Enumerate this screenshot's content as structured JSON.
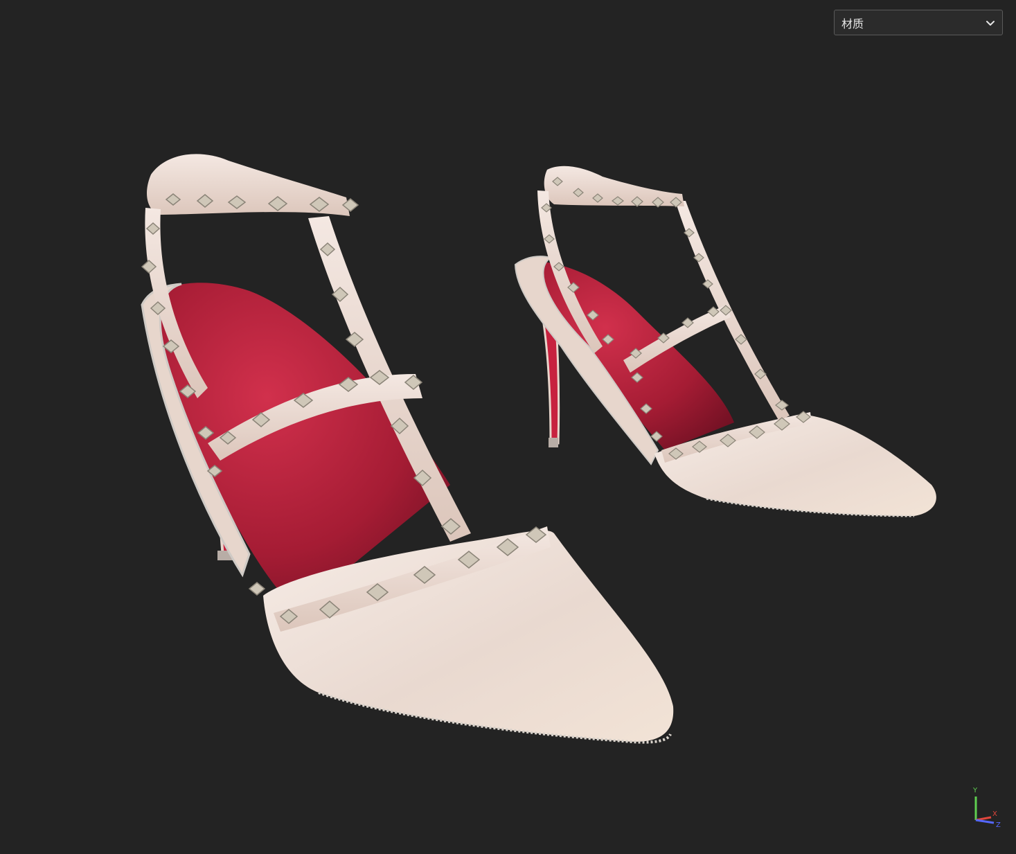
{
  "viewer": {
    "background_color": "#232323"
  },
  "material_select": {
    "selected": "材质",
    "icon": "chevron-down-icon"
  },
  "axis_gizmo": {
    "y_label": "Y",
    "x_label": "X",
    "z_label": "Z",
    "colors": {
      "x": "#e0463c",
      "y": "#5fcf50",
      "z": "#5567ff"
    }
  },
  "model": {
    "upper_color": "#efe0d8",
    "lining_color": "#b0213a",
    "stud_color": "#c9c2b4"
  }
}
